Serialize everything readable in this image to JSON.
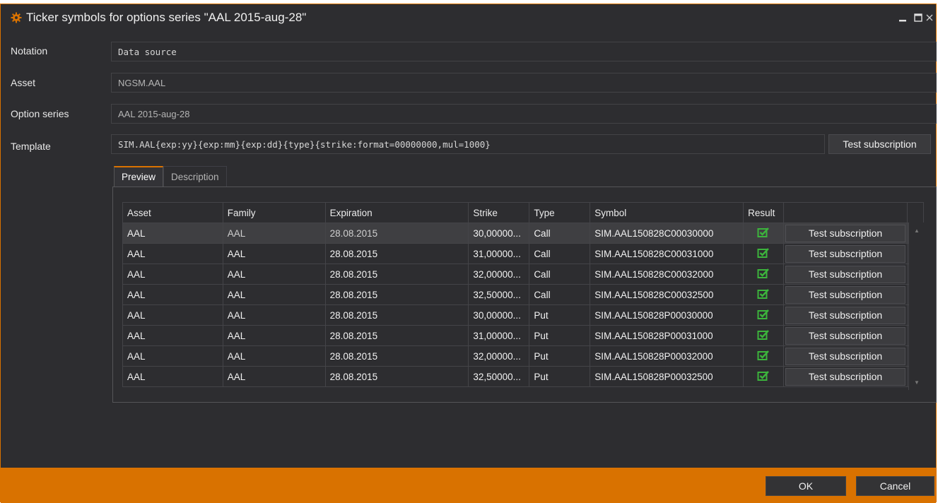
{
  "window": {
    "title": "Ticker symbols for options series \"AAL 2015-aug-28\"",
    "accent": "#d97200"
  },
  "fields": {
    "notation": {
      "label": "Notation",
      "value": "Data source"
    },
    "asset": {
      "label": "Asset",
      "value": "NGSM.AAL"
    },
    "option_series": {
      "label": "Option series",
      "value": "AAL 2015-aug-28"
    },
    "template": {
      "label": "Template",
      "value": "SIM.AAL{exp:yy}{exp:mm}{exp:dd}{type}{strike:format=00000000,mul=1000}",
      "button": "Test subscription"
    }
  },
  "tabs": [
    "Preview",
    "Description"
  ],
  "table": {
    "columns": [
      "Asset",
      "Family",
      "Expiration",
      "Strike",
      "Type",
      "Symbol",
      "Result",
      ""
    ],
    "rows": [
      {
        "asset": "AAL",
        "family": "AAL",
        "expiration": "28.08.2015",
        "strike": "30,00000...",
        "type": "Call",
        "symbol": "SIM.AAL150828C00030000",
        "action": "Test subscription"
      },
      {
        "asset": "AAL",
        "family": "AAL",
        "expiration": "28.08.2015",
        "strike": "31,00000...",
        "type": "Call",
        "symbol": "SIM.AAL150828C00031000",
        "action": "Test subscription"
      },
      {
        "asset": "AAL",
        "family": "AAL",
        "expiration": "28.08.2015",
        "strike": "32,00000...",
        "type": "Call",
        "symbol": "SIM.AAL150828C00032000",
        "action": "Test subscription"
      },
      {
        "asset": "AAL",
        "family": "AAL",
        "expiration": "28.08.2015",
        "strike": "32,50000...",
        "type": "Call",
        "symbol": "SIM.AAL150828C00032500",
        "action": "Test subscription"
      },
      {
        "asset": "AAL",
        "family": "AAL",
        "expiration": "28.08.2015",
        "strike": "30,00000...",
        "type": "Put",
        "symbol": "SIM.AAL150828P00030000",
        "action": "Test subscription"
      },
      {
        "asset": "AAL",
        "family": "AAL",
        "expiration": "28.08.2015",
        "strike": "31,00000...",
        "type": "Put",
        "symbol": "SIM.AAL150828P00031000",
        "action": "Test subscription"
      },
      {
        "asset": "AAL",
        "family": "AAL",
        "expiration": "28.08.2015",
        "strike": "32,00000...",
        "type": "Put",
        "symbol": "SIM.AAL150828P00032000",
        "action": "Test subscription"
      },
      {
        "asset": "AAL",
        "family": "AAL",
        "expiration": "28.08.2015",
        "strike": "32,50000...",
        "type": "Put",
        "symbol": "SIM.AAL150828P00032500",
        "action": "Test subscription"
      }
    ],
    "result_icon": "check-icon",
    "result_color": "#3cb43c"
  },
  "footer": {
    "ok": "OK",
    "cancel": "Cancel"
  }
}
